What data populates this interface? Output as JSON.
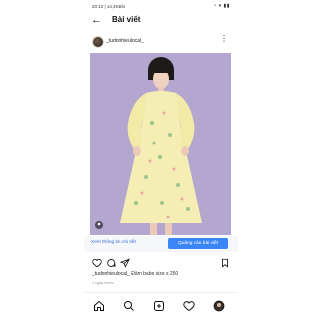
{
  "status_bar": {
    "time": "20:12 | 14,4KB/s",
    "indicators": "◔ ▾ ▮▮"
  },
  "header": {
    "back_icon": "arrow-left-icon",
    "title": "Bài viết"
  },
  "post": {
    "username": "_tudonhieulocal_",
    "more_icon": "more-vertical-icon",
    "image_description_colors": {
      "background": "#b3a6cf",
      "dress": "#f5eeb4"
    },
    "promo": {
      "link_label": "Xem thông tin chi tiết",
      "button_label": "Quảng cáo bài viết"
    },
    "actions": [
      "heart-icon",
      "comment-icon",
      "send-icon",
      "bookmark-icon"
    ],
    "caption_user": "_tudonhieulocal_",
    "caption_text": "Đầm babe size s 250",
    "time_ago": "1 ngày trước"
  },
  "bottom_nav": [
    "home-icon",
    "search-icon",
    "add-post-icon",
    "heart-icon",
    "profile-avatar-icon"
  ],
  "colors": {
    "accent": "#3a86f7",
    "link": "#3a6fd8"
  }
}
